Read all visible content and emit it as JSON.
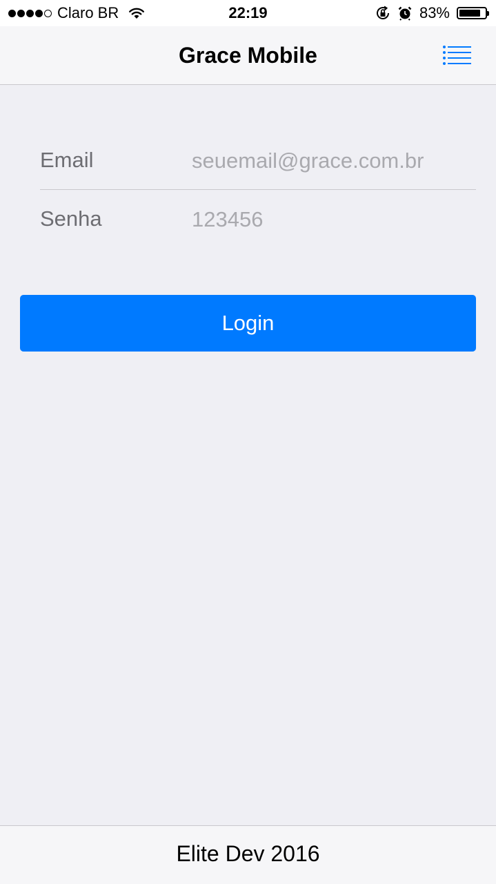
{
  "status_bar": {
    "carrier": "Claro BR",
    "time": "22:19",
    "battery_percent_text": "83%",
    "battery_level": 0.83,
    "signal_bars_filled": 4,
    "signal_bars_total": 5
  },
  "nav": {
    "title": "Grace Mobile",
    "menu_icon": "list-icon"
  },
  "form": {
    "email_label": "Email",
    "email_placeholder": "seuemail@grace.com.br",
    "password_label": "Senha",
    "password_placeholder": "123456"
  },
  "login_button": {
    "label": "Login"
  },
  "footer": {
    "text": "Elite Dev 2016"
  },
  "colors": {
    "accent": "#007aff",
    "background": "#efeff4",
    "bar_background": "#f6f6f8",
    "label_gray": "#6d6d72",
    "placeholder_gray": "#a9a9ae"
  }
}
